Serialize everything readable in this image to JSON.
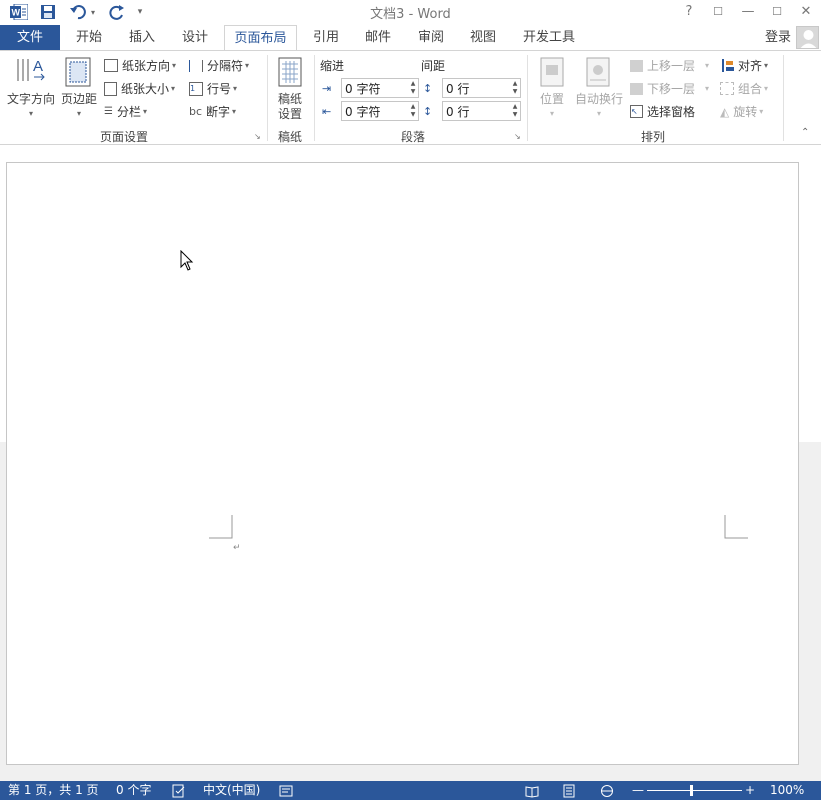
{
  "titlebar": {
    "title": "文档3 - Word",
    "help": "?",
    "minimize": "—",
    "restore": "☐",
    "close": "✕"
  },
  "tabs": {
    "file": "文件",
    "items": [
      "开始",
      "插入",
      "设计",
      "页面布局",
      "引用",
      "邮件",
      "审阅",
      "视图",
      "开发工具"
    ],
    "active": "页面布局",
    "login": "登录"
  },
  "ribbon": {
    "page_setup": {
      "label": "页面设置",
      "text_direction": "文字方向",
      "margins": "页边距",
      "orientation": "纸张方向",
      "size": "纸张大小",
      "columns": "分栏",
      "breaks": "分隔符",
      "line_numbers": "行号",
      "hyphenation": "断字"
    },
    "manuscript": {
      "label": "稿纸",
      "button": "稿纸\n设置",
      "line1": "稿纸",
      "line2": "设置"
    },
    "paragraph": {
      "label": "段落",
      "indent": "缩进",
      "spacing": "间距",
      "indent_left": "0 字符",
      "indent_right": "0 字符",
      "spacing_before": "0 行",
      "spacing_after": "0 行"
    },
    "arrange": {
      "label": "排列",
      "position": "位置",
      "wrap_text": "自动换行",
      "bring_forward": "上移一层",
      "send_backward": "下移一层",
      "selection_pane": "选择窗格",
      "align": "对齐",
      "group": "组合",
      "rotate": "旋转"
    }
  },
  "statusbar": {
    "page": "第 1 页，共 1 页",
    "words": "0 个字",
    "language": "中文(中国)",
    "zoom": "100%",
    "zoom_minus": "—",
    "zoom_plus": "+"
  },
  "colors": {
    "accent": "#2b579a",
    "ribbon_bg": "#ffffff",
    "doc_bg": "#f0f0f0"
  }
}
